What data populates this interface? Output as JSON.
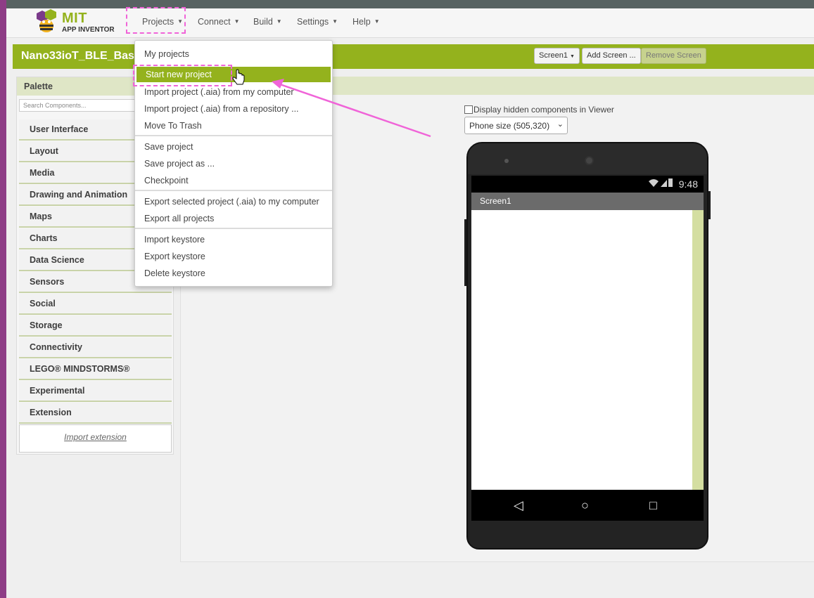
{
  "app": {
    "logo_main": "MIT",
    "logo_sub": "APP INVENTOR"
  },
  "nav": {
    "items": [
      {
        "label": "Projects"
      },
      {
        "label": "Connect"
      },
      {
        "label": "Build"
      },
      {
        "label": "Settings"
      },
      {
        "label": "Help"
      }
    ]
  },
  "project": {
    "name": "Nano33ioT_BLE_Bas",
    "screen_select": "Screen1",
    "add_screen": "Add Screen ...",
    "remove_screen": "Remove Screen"
  },
  "palette": {
    "title": "Palette",
    "search_placeholder": "Search Components...",
    "categories": [
      "User Interface",
      "Layout",
      "Media",
      "Drawing and Animation",
      "Maps",
      "Charts",
      "Data Science",
      "Sensors",
      "Social",
      "Storage",
      "Connectivity",
      "LEGO® MINDSTORMS®",
      "Experimental",
      "Extension"
    ],
    "import_extension": "Import extension"
  },
  "viewer": {
    "hidden_components_label": "Display hidden components in Viewer",
    "phone_size": "Phone size (505,320)",
    "status_time": "9:48",
    "screen_title": "Screen1"
  },
  "menu": {
    "items": [
      {
        "label": "My projects"
      },
      {
        "label": "Start new project"
      },
      {
        "label": "Import project (.aia) from my computer"
      },
      {
        "label": "Import project (.aia) from a repository ..."
      },
      {
        "label": "Move To Trash"
      },
      {
        "label": "Save project"
      },
      {
        "label": "Save project as ..."
      },
      {
        "label": "Checkpoint"
      },
      {
        "label": "Export selected project (.aia) to my computer"
      },
      {
        "label": "Export all projects"
      },
      {
        "label": "Import keystore"
      },
      {
        "label": "Export keystore"
      },
      {
        "label": "Delete keystore"
      }
    ],
    "active_item": "Start new project"
  },
  "colors": {
    "accent_green": "#94b21d",
    "annotation_pink": "#f064d8"
  }
}
